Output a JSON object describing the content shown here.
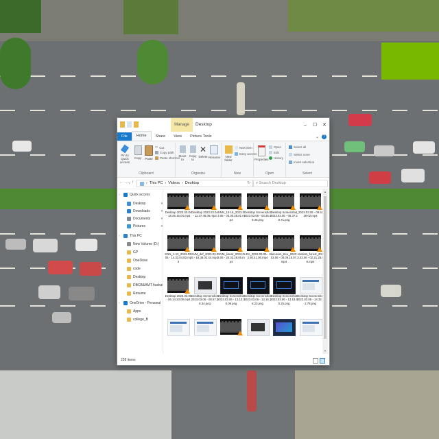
{
  "window": {
    "title": "Desktop",
    "contextual_tab": "Manage",
    "controls": {
      "minimize": "–",
      "maximize": "☐",
      "close": "✕"
    }
  },
  "ribbon_tabs": [
    "File",
    "Home",
    "Share",
    "View",
    "Picture Tools"
  ],
  "ribbon": {
    "clipboard": {
      "label": "Clipboard",
      "pin": "Pin to Quick access",
      "copy": "Copy",
      "paste": "Paste",
      "cut": "Cut",
      "copy_path": "Copy path",
      "paste_shortcut": "Paste shortcut"
    },
    "organize": {
      "label": "Organize",
      "move_to": "Move to",
      "copy_to": "Copy to",
      "delete": "Delete",
      "rename": "Rename"
    },
    "new": {
      "label": "New",
      "new_folder": "New folder",
      "new_item": "New item",
      "easy_access": "Easy access"
    },
    "open": {
      "label": "Open",
      "properties": "Properties",
      "open": "Open",
      "edit": "Edit",
      "history": "History"
    },
    "select": {
      "label": "Select",
      "select_all": "Select all",
      "select_none": "Select none",
      "invert": "Invert selection"
    }
  },
  "address": {
    "back": "←",
    "forward": "→",
    "recent": "∨",
    "up": "↑",
    "path": [
      "This PC",
      "Videos",
      "Desktop"
    ],
    "separator": "›",
    "search_placeholder": "Search Desktop"
  },
  "sidebar": {
    "items": [
      {
        "label": "Quick access",
        "icon": "star-icon",
        "color": "#1979ca",
        "pinned": false
      },
      {
        "label": "Desktop",
        "icon": "desktop-icon",
        "color": "#3a8fd8",
        "pinned": true
      },
      {
        "label": "Downloads",
        "icon": "download-icon",
        "color": "#2a7fd0",
        "pinned": true
      },
      {
        "label": "Documents",
        "icon": "document-icon",
        "color": "#7e8c9a",
        "pinned": true
      },
      {
        "label": "Pictures",
        "icon": "picture-icon",
        "color": "#3a9ad8",
        "pinned": true
      },
      {
        "label": "This PC",
        "icon": "computer-icon",
        "color": "#2f7fc6",
        "pinned": false
      },
      {
        "label": "New Volume (D:)",
        "icon": "drive-icon",
        "color": "#8a8a8a",
        "pinned": false
      },
      {
        "label": "GP",
        "icon": "folder-icon",
        "color": "#e8b84a",
        "pinned": false
      },
      {
        "label": "OneDrive",
        "icon": "folder-icon",
        "color": "#e8b84a",
        "pinned": false
      },
      {
        "label": "code",
        "icon": "folder-icon",
        "color": "#e8b84a",
        "pinned": false
      },
      {
        "label": "Desktop",
        "icon": "folder-icon",
        "color": "#e8b84a",
        "pinned": false
      },
      {
        "label": "DBCB&AMT hackathon",
        "icon": "folder-icon",
        "color": "#e8b84a",
        "pinned": false
      },
      {
        "label": "Resume",
        "icon": "folder-icon",
        "color": "#e8b84a",
        "pinned": false
      },
      {
        "label": "OneDrive - Personal",
        "icon": "cloud-icon",
        "color": "#1979ca",
        "pinned": false
      },
      {
        "label": "Apps",
        "icon": "folder-icon",
        "color": "#e8b84a",
        "pinned": false
      },
      {
        "label": "college_B",
        "icon": "folder-icon",
        "color": "#e8b84a",
        "pinned": false
      }
    ]
  },
  "files": [
    {
      "name": "Desktop 2023.03.04 - 18.26.16.04.mp4",
      "kind": "video"
    },
    {
      "name": "Desktop 2023.03.04 - 11.37.45.05.mp4",
      "kind": "video"
    },
    {
      "name": "KNN_13-16_2023.03.05 - 03.30.35.01.mp4",
      "kind": "video"
    },
    {
      "name": "Desktop Screenshot 2023.03.05 - 03.35.48.46.png",
      "kind": "video"
    },
    {
      "name": "Desktop Screenshot 2023.03.05 - 05.37.28.71.png",
      "kind": "video"
    },
    {
      "name": "_2023.03.05 - 09.42.19.02.mp4",
      "kind": "video"
    },
    {
      "name": "KNN_1-12_2023.03.05 - 14.33.04.83.mp4",
      "kind": "video"
    },
    {
      "name": "SVM_def_2023.03.05 - 18.38.02.44.mp4",
      "kind": "video"
    },
    {
      "name": "SVM_linear_2023.03.05 - 20.33.28.05.mp4",
      "kind": "video"
    },
    {
      "name": "LDA_2023.03.05 - 22.50.41.06.mp4",
      "kind": "video"
    },
    {
      "name": "decision_tree_2023.03.06 - 00.09.15.07.mp4",
      "kind": "video"
    },
    {
      "name": "random_forest_2023.03.06 - 02.21.25.08.mp4",
      "kind": "video"
    },
    {
      "name": "Desktop 2023.03.06 - 06.14.23.09.mp4",
      "kind": "video"
    },
    {
      "name": "Desktop Screenshot 2023.03.06 - 08.57.38.34.png",
      "kind": "gray"
    },
    {
      "name": "Desktop Screenshot 2023.03.06 - 13.13.30.08.png",
      "kind": "dark"
    },
    {
      "name": "Desktop Screenshot 2023.03.06 - 13.16.16.23.png",
      "kind": "dark"
    },
    {
      "name": "Desktop Screenshot 2023.03.06 - 13.18.45.25.png",
      "kind": "dark"
    },
    {
      "name": "Desktop Screenshot 2023.03.06 - 14.32.02.78.png",
      "kind": "light"
    },
    {
      "name": "",
      "kind": "light"
    },
    {
      "name": "",
      "kind": "light"
    },
    {
      "name": "",
      "kind": "video"
    },
    {
      "name": "",
      "kind": "gray"
    },
    {
      "name": "",
      "kind": "blue"
    },
    {
      "name": "",
      "kind": "light"
    }
  ],
  "status": {
    "count": "228 items"
  }
}
